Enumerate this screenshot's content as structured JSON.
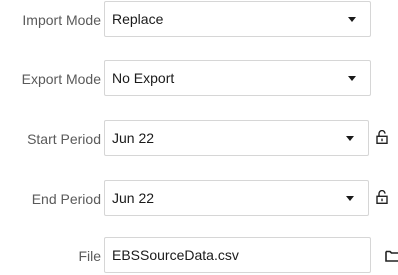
{
  "import_mode": {
    "label": "Import Mode",
    "value": "Replace"
  },
  "export_mode": {
    "label": "Export Mode",
    "value": "No Export"
  },
  "start_period": {
    "label": "Start Period",
    "value": "Jun 22"
  },
  "end_period": {
    "label": "End Period",
    "value": "Jun 22"
  },
  "file": {
    "label": "File",
    "value": "EBSSourceData.csv"
  },
  "icons": {
    "dropdown": "chevron-down-icon",
    "lock": "unlock-icon",
    "file_browse": "folder-icon"
  }
}
